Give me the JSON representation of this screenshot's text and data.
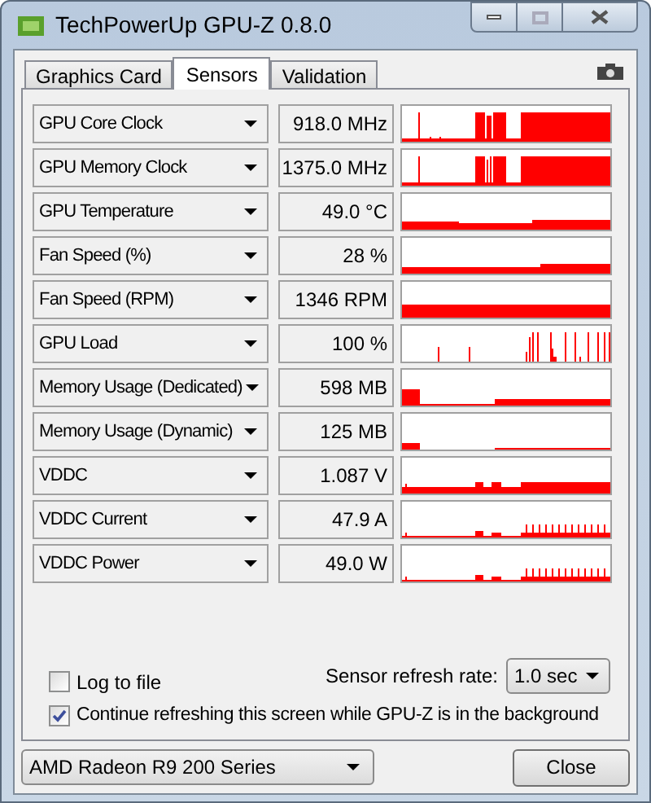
{
  "window": {
    "title": "TechPowerUp GPU-Z 0.8.0"
  },
  "tabs": [
    {
      "label": "Graphics Card",
      "selected": false
    },
    {
      "label": "Sensors",
      "selected": true
    },
    {
      "label": "Validation",
      "selected": false
    }
  ],
  "sensors": [
    {
      "name": "GPU Core Clock",
      "value": "918.0 MHz"
    },
    {
      "name": "GPU Memory Clock",
      "value": "1375.0 MHz"
    },
    {
      "name": "GPU Temperature",
      "value": "49.0 °C"
    },
    {
      "name": "Fan Speed (%)",
      "value": "28 %"
    },
    {
      "name": "Fan Speed (RPM)",
      "value": "1346 RPM"
    },
    {
      "name": "GPU Load",
      "value": "100 %"
    },
    {
      "name": "Memory Usage (Dedicated)",
      "value": "598 MB"
    },
    {
      "name": "Memory Usage (Dynamic)",
      "value": "125 MB"
    },
    {
      "name": "VDDC",
      "value": "1.087 V"
    },
    {
      "name": "VDDC Current",
      "value": "47.9 A"
    },
    {
      "name": "VDDC Power",
      "value": "49.0 W"
    }
  ],
  "log_to_file": {
    "label": "Log to file",
    "checked": false
  },
  "refresh_rate": {
    "label": "Sensor refresh rate:",
    "value": "1.0 sec"
  },
  "continue_refreshing": {
    "label": "Continue refreshing this screen while GPU-Z is in the background",
    "checked": true
  },
  "gpu_select": {
    "value": "AMD Radeon R9 200 Series"
  },
  "close_button": {
    "label": "Close"
  }
}
